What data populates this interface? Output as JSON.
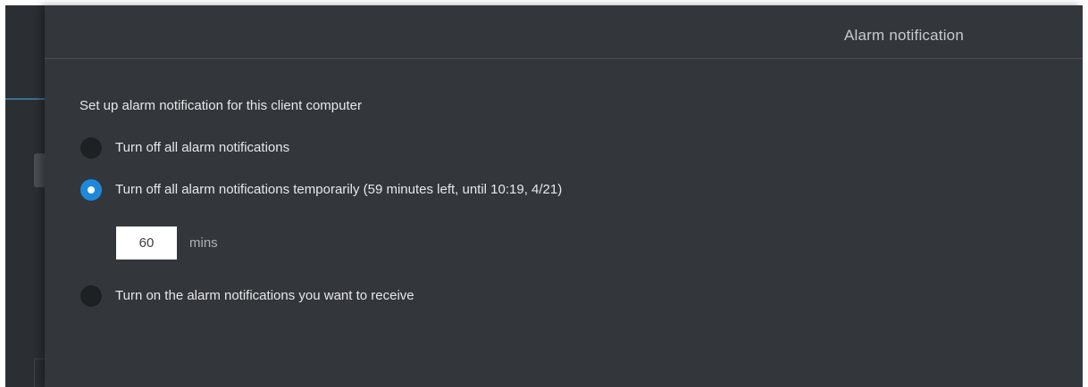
{
  "panel": {
    "title": "Alarm notification"
  },
  "intro_text": "Set up alarm notification for this client computer",
  "options": [
    {
      "label": "Turn off all alarm notifications",
      "checked": false
    },
    {
      "label": "Turn off all alarm notifications temporarily (59 minutes left, until 10:19, 4/21)",
      "checked": true
    },
    {
      "label": "Turn on the alarm notifications you want to receive",
      "checked": false
    }
  ],
  "duration": {
    "value": "60",
    "unit": "mins"
  },
  "colors": {
    "panel_background": "#33373b",
    "accent_selected": "#1d88dc",
    "radio_unselected": "#1e2124"
  }
}
